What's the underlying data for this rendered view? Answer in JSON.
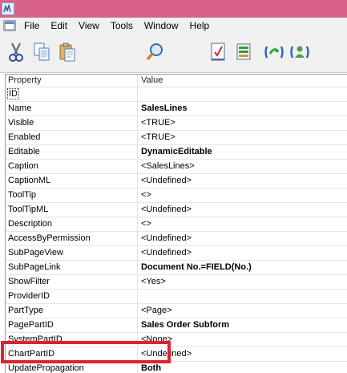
{
  "menu": {
    "items": [
      "File",
      "Edit",
      "View",
      "Tools",
      "Window",
      "Help"
    ]
  },
  "toolbar": {
    "buttons": [
      {
        "name": "cut-icon"
      },
      {
        "name": "copy-icon"
      },
      {
        "name": "paste-icon"
      },
      {
        "name": "find-icon"
      },
      {
        "name": "properties-icon"
      },
      {
        "name": "database-icon"
      },
      {
        "name": "refresh-link-icon"
      },
      {
        "name": "user-link-icon"
      }
    ]
  },
  "grid": {
    "header": {
      "property": "Property",
      "value": "Value"
    },
    "rows": [
      {
        "property": "ID",
        "value": "",
        "bold": false
      },
      {
        "property": "Name",
        "value": "SalesLines",
        "bold": true
      },
      {
        "property": "Visible",
        "value": "<TRUE>",
        "bold": false
      },
      {
        "property": "Enabled",
        "value": "<TRUE>",
        "bold": false
      },
      {
        "property": "Editable",
        "value": "DynamicEditable",
        "bold": true
      },
      {
        "property": "Caption",
        "value": "<SalesLines>",
        "bold": false
      },
      {
        "property": "CaptionML",
        "value": "<Undefined>",
        "bold": false
      },
      {
        "property": "ToolTip",
        "value": "<>",
        "bold": false
      },
      {
        "property": "ToolTipML",
        "value": "<Undefined>",
        "bold": false
      },
      {
        "property": "Description",
        "value": "<>",
        "bold": false
      },
      {
        "property": "AccessByPermission",
        "value": "<Undefined>",
        "bold": false
      },
      {
        "property": "SubPageView",
        "value": "<Undefined>",
        "bold": false
      },
      {
        "property": "SubPageLink",
        "value": "Document No.=FIELD(No.)",
        "bold": true
      },
      {
        "property": "ShowFilter",
        "value": "<Yes>",
        "bold": false
      },
      {
        "property": "ProviderID",
        "value": "",
        "bold": false
      },
      {
        "property": "PartType",
        "value": "<Page>",
        "bold": false
      },
      {
        "property": "PagePartID",
        "value": "Sales Order Subform",
        "bold": true
      },
      {
        "property": "SystemPartID",
        "value": "<None>",
        "bold": false
      },
      {
        "property": "ChartPartID",
        "value": "<Undefined>",
        "bold": false
      },
      {
        "property": "UpdatePropagation",
        "value": "Both",
        "bold": true
      }
    ]
  },
  "colors": {
    "titlebar": "#d8628c",
    "highlight": "#e0222c"
  }
}
